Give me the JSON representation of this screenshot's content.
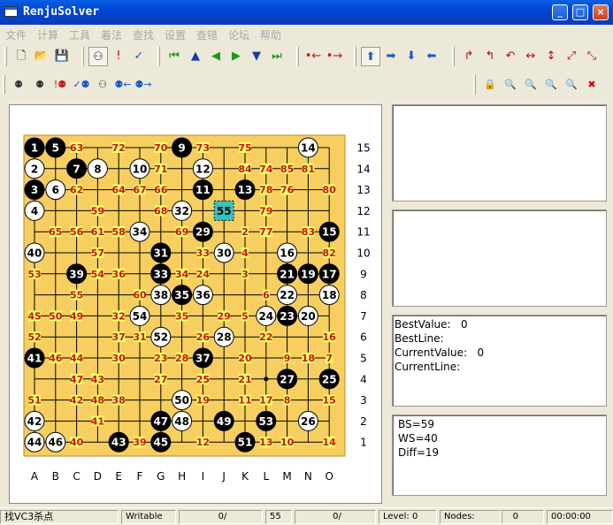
{
  "window": {
    "title": "RenjuSolver",
    "minimize_glyph": "_",
    "maximize_glyph": "□",
    "close_glyph": "×"
  },
  "menu": [
    "文件",
    "计算",
    "工具",
    "着法",
    "查找",
    "设置",
    "查错",
    "论坛",
    "帮助"
  ],
  "toolbar1": [
    {
      "name": "new-file-icon",
      "glyph": "🗋",
      "color": "#222"
    },
    {
      "name": "open-folder-icon",
      "glyph": "📂",
      "color": "#c08a1e"
    },
    {
      "name": "save-disk-icon",
      "glyph": "💾",
      "color": "#222"
    },
    {
      "name": "stones-mode-icon",
      "glyph": "⚇",
      "color": "#222",
      "selected": true
    },
    {
      "name": "exclamation-icon",
      "glyph": "!",
      "color": "#d40000"
    },
    {
      "name": "check-icon",
      "glyph": "✓",
      "color": "#1a56c8"
    },
    {
      "name": "first-move-icon",
      "glyph": "⏮",
      "color": "#1a9a1a"
    },
    {
      "name": "up-triangle-icon",
      "glyph": "▲",
      "color": "#1a3aa8"
    },
    {
      "name": "back-move-icon",
      "glyph": "◀",
      "color": "#1a9a1a"
    },
    {
      "name": "forward-move-icon",
      "glyph": "▶",
      "color": "#1a9a1a"
    },
    {
      "name": "down-triangle-icon",
      "glyph": "▼",
      "color": "#1a3aa8"
    },
    {
      "name": "last-move-icon",
      "glyph": "⏭",
      "color": "#1a9a1a"
    },
    {
      "name": "shift-left-icon",
      "glyph": "•←",
      "color": "#c81414"
    },
    {
      "name": "shift-right-icon",
      "glyph": "•→",
      "color": "#c81414"
    },
    {
      "name": "arrow-up-icon",
      "glyph": "⬆",
      "color": "#1a56c8",
      "selected": true
    },
    {
      "name": "arrow-right-icon",
      "glyph": "➡",
      "color": "#1a56c8"
    },
    {
      "name": "arrow-down-icon",
      "glyph": "⬇",
      "color": "#1a56c8"
    },
    {
      "name": "arrow-left-icon",
      "glyph": "⬅",
      "color": "#1a56c8"
    },
    {
      "name": "rotate-cw-icon",
      "glyph": "↱",
      "color": "#b41010"
    },
    {
      "name": "rotate-ccw-icon",
      "glyph": "↰",
      "color": "#b41010"
    },
    {
      "name": "rotate-180-icon",
      "glyph": "↶",
      "color": "#b41010"
    },
    {
      "name": "flip-horizontal-icon",
      "glyph": "↔",
      "color": "#b41010"
    },
    {
      "name": "flip-vertical-icon",
      "glyph": "↕",
      "color": "#b41010"
    },
    {
      "name": "flip-diagonal-icon",
      "glyph": "⤢",
      "color": "#b41010"
    },
    {
      "name": "flip-antidiagonal-icon",
      "glyph": "⤡",
      "color": "#b41010"
    }
  ],
  "toolbar2": [
    {
      "name": "search-vcf-icon",
      "glyph": "⚉",
      "color": "#333"
    },
    {
      "name": "search-vct-icon",
      "glyph": "⚉",
      "color": "#333"
    },
    {
      "name": "search-fail-icon",
      "glyph": "!⚉",
      "color": "#c81414"
    },
    {
      "name": "search-check-icon",
      "glyph": "✓⚉",
      "color": "#1a56c8"
    },
    {
      "name": "search-both-icon",
      "glyph": "⚇",
      "color": "#333"
    },
    {
      "name": "search-back-icon",
      "glyph": "⚉←",
      "color": "#1a56c8"
    },
    {
      "name": "search-forward-icon",
      "glyph": "⚉→",
      "color": "#1a56c8"
    },
    {
      "name": "lock-icon",
      "glyph": "🔒",
      "color": "#333"
    },
    {
      "name": "zoom-search-icon",
      "glyph": "🔍",
      "color": "#d40000"
    },
    {
      "name": "zoom-out-icon",
      "glyph": "🔍",
      "color": "#d40000"
    },
    {
      "name": "zoom-blue-icon",
      "glyph": "🔍",
      "color": "#1a56c8"
    },
    {
      "name": "zoom-out-blue-icon",
      "glyph": "🔍",
      "color": "#1a56c8"
    },
    {
      "name": "delete-x-icon",
      "glyph": "✖",
      "color": "#d40000"
    }
  ],
  "board": {
    "size": 15,
    "board_color": "#f7cf60",
    "label_color": "#c81414",
    "label_bg": "#ffff66",
    "row_labels": [
      "15",
      "14",
      "13",
      "12",
      "11",
      "10",
      "9",
      "8",
      "7",
      "6",
      "5",
      "4",
      "3",
      "2",
      "1"
    ],
    "col_labels": [
      "A",
      "B",
      "C",
      "D",
      "E",
      "F",
      "G",
      "H",
      "I",
      "J",
      "K",
      "L",
      "M",
      "N",
      "O"
    ],
    "stones": [
      {
        "col": 1,
        "row": 15,
        "color": "black",
        "num": "1"
      },
      {
        "col": 2,
        "row": 15,
        "color": "black",
        "num": "5"
      },
      {
        "col": 8,
        "row": 15,
        "color": "black",
        "num": "9"
      },
      {
        "col": 14,
        "row": 15,
        "color": "white",
        "num": "14"
      },
      {
        "col": 1,
        "row": 14,
        "color": "white",
        "num": "2"
      },
      {
        "col": 3,
        "row": 14,
        "color": "black",
        "num": "7"
      },
      {
        "col": 4,
        "row": 14,
        "color": "white",
        "num": "8"
      },
      {
        "col": 6,
        "row": 14,
        "color": "white",
        "num": "10"
      },
      {
        "col": 9,
        "row": 14,
        "color": "white",
        "num": "12"
      },
      {
        "col": 1,
        "row": 13,
        "color": "black",
        "num": "3"
      },
      {
        "col": 2,
        "row": 13,
        "color": "white",
        "num": "6"
      },
      {
        "col": 9,
        "row": 13,
        "color": "black",
        "num": "11"
      },
      {
        "col": 11,
        "row": 13,
        "color": "black",
        "num": "13"
      },
      {
        "col": 1,
        "row": 12,
        "color": "white",
        "num": "4"
      },
      {
        "col": 8,
        "row": 12,
        "color": "white",
        "num": "32"
      },
      {
        "col": 10,
        "row": 12,
        "color": "cursor",
        "num": "55"
      },
      {
        "col": 6,
        "row": 11,
        "color": "white",
        "num": "34"
      },
      {
        "col": 9,
        "row": 11,
        "color": "black",
        "num": "29"
      },
      {
        "col": 15,
        "row": 11,
        "color": "black",
        "num": "15"
      },
      {
        "col": 1,
        "row": 10,
        "color": "white",
        "num": "40"
      },
      {
        "col": 7,
        "row": 10,
        "color": "black",
        "num": "31"
      },
      {
        "col": 10,
        "row": 10,
        "color": "white",
        "num": "30"
      },
      {
        "col": 13,
        "row": 10,
        "color": "white",
        "num": "16"
      },
      {
        "col": 3,
        "row": 9,
        "color": "black",
        "num": "39"
      },
      {
        "col": 7,
        "row": 9,
        "color": "black",
        "num": "33"
      },
      {
        "col": 13,
        "row": 9,
        "color": "black",
        "num": "21"
      },
      {
        "col": 14,
        "row": 9,
        "color": "black",
        "num": "19"
      },
      {
        "col": 15,
        "row": 9,
        "color": "black",
        "num": "17"
      },
      {
        "col": 7,
        "row": 8,
        "color": "white",
        "num": "38"
      },
      {
        "col": 8,
        "row": 8,
        "color": "black",
        "num": "35"
      },
      {
        "col": 9,
        "row": 8,
        "color": "white",
        "num": "36"
      },
      {
        "col": 13,
        "row": 8,
        "color": "white",
        "num": "22"
      },
      {
        "col": 15,
        "row": 8,
        "color": "white",
        "num": "18"
      },
      {
        "col": 6,
        "row": 7,
        "color": "white",
        "num": "54"
      },
      {
        "col": 12,
        "row": 7,
        "color": "white",
        "num": "24"
      },
      {
        "col": 13,
        "row": 7,
        "color": "black",
        "num": "23"
      },
      {
        "col": 14,
        "row": 7,
        "color": "white",
        "num": "20"
      },
      {
        "col": 7,
        "row": 6,
        "color": "white",
        "num": "52"
      },
      {
        "col": 10,
        "row": 6,
        "color": "white",
        "num": "28"
      },
      {
        "col": 1,
        "row": 5,
        "color": "black",
        "num": "41"
      },
      {
        "col": 9,
        "row": 5,
        "color": "black",
        "num": "37"
      },
      {
        "col": 13,
        "row": 4,
        "color": "black",
        "num": "27"
      },
      {
        "col": 15,
        "row": 4,
        "color": "black",
        "num": "25"
      },
      {
        "col": 8,
        "row": 3,
        "color": "white",
        "num": "50"
      },
      {
        "col": 1,
        "row": 2,
        "color": "white",
        "num": "42"
      },
      {
        "col": 7,
        "row": 2,
        "color": "black",
        "num": "47"
      },
      {
        "col": 8,
        "row": 2,
        "color": "white",
        "num": "48"
      },
      {
        "col": 10,
        "row": 2,
        "color": "black",
        "num": "49"
      },
      {
        "col": 12,
        "row": 2,
        "color": "black",
        "num": "53"
      },
      {
        "col": 14,
        "row": 2,
        "color": "white",
        "num": "26"
      },
      {
        "col": 1,
        "row": 1,
        "color": "white",
        "num": "44"
      },
      {
        "col": 2,
        "row": 1,
        "color": "white",
        "num": "46"
      },
      {
        "col": 5,
        "row": 1,
        "color": "black",
        "num": "43"
      },
      {
        "col": 7,
        "row": 1,
        "color": "black",
        "num": "45"
      },
      {
        "col": 11,
        "row": 1,
        "color": "black",
        "num": "51"
      }
    ],
    "labels": [
      {
        "col": 3,
        "row": 15,
        "num": "63"
      },
      {
        "col": 5,
        "row": 15,
        "num": "72"
      },
      {
        "col": 7,
        "row": 15,
        "num": "70"
      },
      {
        "col": 9,
        "row": 15,
        "num": "73"
      },
      {
        "col": 11,
        "row": 15,
        "num": "75"
      },
      {
        "col": 7,
        "row": 14,
        "num": "71"
      },
      {
        "col": 11,
        "row": 14,
        "num": "84"
      },
      {
        "col": 12,
        "row": 14,
        "num": "74"
      },
      {
        "col": 13,
        "row": 14,
        "num": "85"
      },
      {
        "col": 14,
        "row": 14,
        "num": "81"
      },
      {
        "col": 3,
        "row": 13,
        "num": "62"
      },
      {
        "col": 5,
        "row": 13,
        "num": "64"
      },
      {
        "col": 6,
        "row": 13,
        "num": "67"
      },
      {
        "col": 7,
        "row": 13,
        "num": "66"
      },
      {
        "col": 12,
        "row": 13,
        "num": "78"
      },
      {
        "col": 13,
        "row": 13,
        "num": "76"
      },
      {
        "col": 15,
        "row": 13,
        "num": "80"
      },
      {
        "col": 4,
        "row": 12,
        "num": "59"
      },
      {
        "col": 7,
        "row": 12,
        "num": "68"
      },
      {
        "col": 12,
        "row": 12,
        "num": "79"
      },
      {
        "col": 2,
        "row": 11,
        "num": "65"
      },
      {
        "col": 3,
        "row": 11,
        "num": "56"
      },
      {
        "col": 4,
        "row": 11,
        "num": "61"
      },
      {
        "col": 5,
        "row": 11,
        "num": "58"
      },
      {
        "col": 8,
        "row": 11,
        "num": "69"
      },
      {
        "col": 11,
        "row": 11,
        "num": "2"
      },
      {
        "col": 12,
        "row": 11,
        "num": "77"
      },
      {
        "col": 14,
        "row": 11,
        "num": "83"
      },
      {
        "col": 4,
        "row": 10,
        "num": "57"
      },
      {
        "col": 9,
        "row": 10,
        "num": "33"
      },
      {
        "col": 11,
        "row": 10,
        "num": "4"
      },
      {
        "col": 15,
        "row": 10,
        "num": "82"
      },
      {
        "col": 1,
        "row": 9,
        "num": "53"
      },
      {
        "col": 4,
        "row": 9,
        "num": "54"
      },
      {
        "col": 5,
        "row": 9,
        "num": "36"
      },
      {
        "col": 8,
        "row": 9,
        "num": "34"
      },
      {
        "col": 9,
        "row": 9,
        "num": "24"
      },
      {
        "col": 11,
        "row": 9,
        "num": "3"
      },
      {
        "col": 3,
        "row": 8,
        "num": "55"
      },
      {
        "col": 6,
        "row": 8,
        "num": "60"
      },
      {
        "col": 12,
        "row": 8,
        "num": "6"
      },
      {
        "col": 1,
        "row": 7,
        "num": "45"
      },
      {
        "col": 2,
        "row": 7,
        "num": "50"
      },
      {
        "col": 3,
        "row": 7,
        "num": "49"
      },
      {
        "col": 5,
        "row": 7,
        "num": "32"
      },
      {
        "col": 8,
        "row": 7,
        "num": "35"
      },
      {
        "col": 10,
        "row": 7,
        "num": "29"
      },
      {
        "col": 11,
        "row": 7,
        "num": "5"
      },
      {
        "col": 1,
        "row": 6,
        "num": "52"
      },
      {
        "col": 5,
        "row": 6,
        "num": "37"
      },
      {
        "col": 6,
        "row": 6,
        "num": "31"
      },
      {
        "col": 9,
        "row": 6,
        "num": "26"
      },
      {
        "col": 12,
        "row": 6,
        "num": "22"
      },
      {
        "col": 15,
        "row": 6,
        "num": "16"
      },
      {
        "col": 2,
        "row": 5,
        "num": "46"
      },
      {
        "col": 3,
        "row": 5,
        "num": "44"
      },
      {
        "col": 5,
        "row": 5,
        "num": "30"
      },
      {
        "col": 7,
        "row": 5,
        "num": "23"
      },
      {
        "col": 8,
        "row": 5,
        "num": "28"
      },
      {
        "col": 11,
        "row": 5,
        "num": "20"
      },
      {
        "col": 13,
        "row": 5,
        "num": "9"
      },
      {
        "col": 14,
        "row": 5,
        "num": "18"
      },
      {
        "col": 15,
        "row": 5,
        "num": "7"
      },
      {
        "col": 3,
        "row": 4,
        "num": "47"
      },
      {
        "col": 4,
        "row": 4,
        "num": "43"
      },
      {
        "col": 7,
        "row": 4,
        "num": "27"
      },
      {
        "col": 9,
        "row": 4,
        "num": "25"
      },
      {
        "col": 11,
        "row": 4,
        "num": "21"
      },
      {
        "col": 1,
        "row": 3,
        "num": "51"
      },
      {
        "col": 3,
        "row": 3,
        "num": "42"
      },
      {
        "col": 4,
        "row": 3,
        "num": "48"
      },
      {
        "col": 5,
        "row": 3,
        "num": "38"
      },
      {
        "col": 9,
        "row": 3,
        "num": "19"
      },
      {
        "col": 11,
        "row": 3,
        "num": "11"
      },
      {
        "col": 12,
        "row": 3,
        "num": "17"
      },
      {
        "col": 13,
        "row": 3,
        "num": "8"
      },
      {
        "col": 15,
        "row": 3,
        "num": "15"
      },
      {
        "col": 4,
        "row": 2,
        "num": "41"
      },
      {
        "col": 3,
        "row": 1,
        "num": "40"
      },
      {
        "col": 6,
        "row": 1,
        "num": "39"
      },
      {
        "col": 9,
        "row": 1,
        "num": "12"
      },
      {
        "col": 12,
        "row": 1,
        "num": "13"
      },
      {
        "col": 13,
        "row": 1,
        "num": "10"
      },
      {
        "col": 15,
        "row": 1,
        "num": "14"
      }
    ],
    "dot": {
      "col": 12,
      "row": 4
    }
  },
  "panels": {
    "info": [
      "BestValue:   0",
      "BestLine:",
      "CurrentValue:   0",
      "CurrentLine:"
    ],
    "stats": [
      "BS=59",
      "WS=40",
      "Diff=19"
    ]
  },
  "status": {
    "task": "找VC3杀点",
    "mode": "Writable",
    "count1": "0/",
    "move_no": "55",
    "count2": "0/",
    "level": "Level: 0",
    "nodes": "Nodes:",
    "nodes_val": "0",
    "time": "00:00:00"
  }
}
